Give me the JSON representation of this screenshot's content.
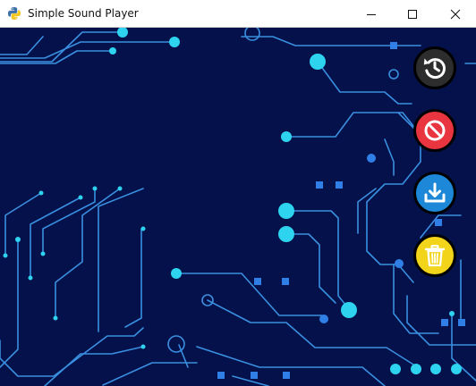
{
  "window": {
    "title": "Simple Sound Player",
    "app_icon": "python-icon",
    "controls": {
      "minimize_icon": "minimize-icon",
      "maximize_icon": "maximize-icon",
      "close_icon": "close-icon"
    }
  },
  "player": {
    "background": "circuit-board",
    "buttons": [
      {
        "id": "replay",
        "icon": "replay-icon",
        "color": "#2d2d2d"
      },
      {
        "id": "stop",
        "icon": "no-entry-icon",
        "color": "#e8353f"
      },
      {
        "id": "download",
        "icon": "download-icon",
        "color": "#1e88d8"
      },
      {
        "id": "delete",
        "icon": "trash-icon",
        "color": "#f2d51b"
      }
    ]
  },
  "colors": {
    "background": "#04114a",
    "trace": "#3a8fe0",
    "node": "#2ed3f0"
  }
}
